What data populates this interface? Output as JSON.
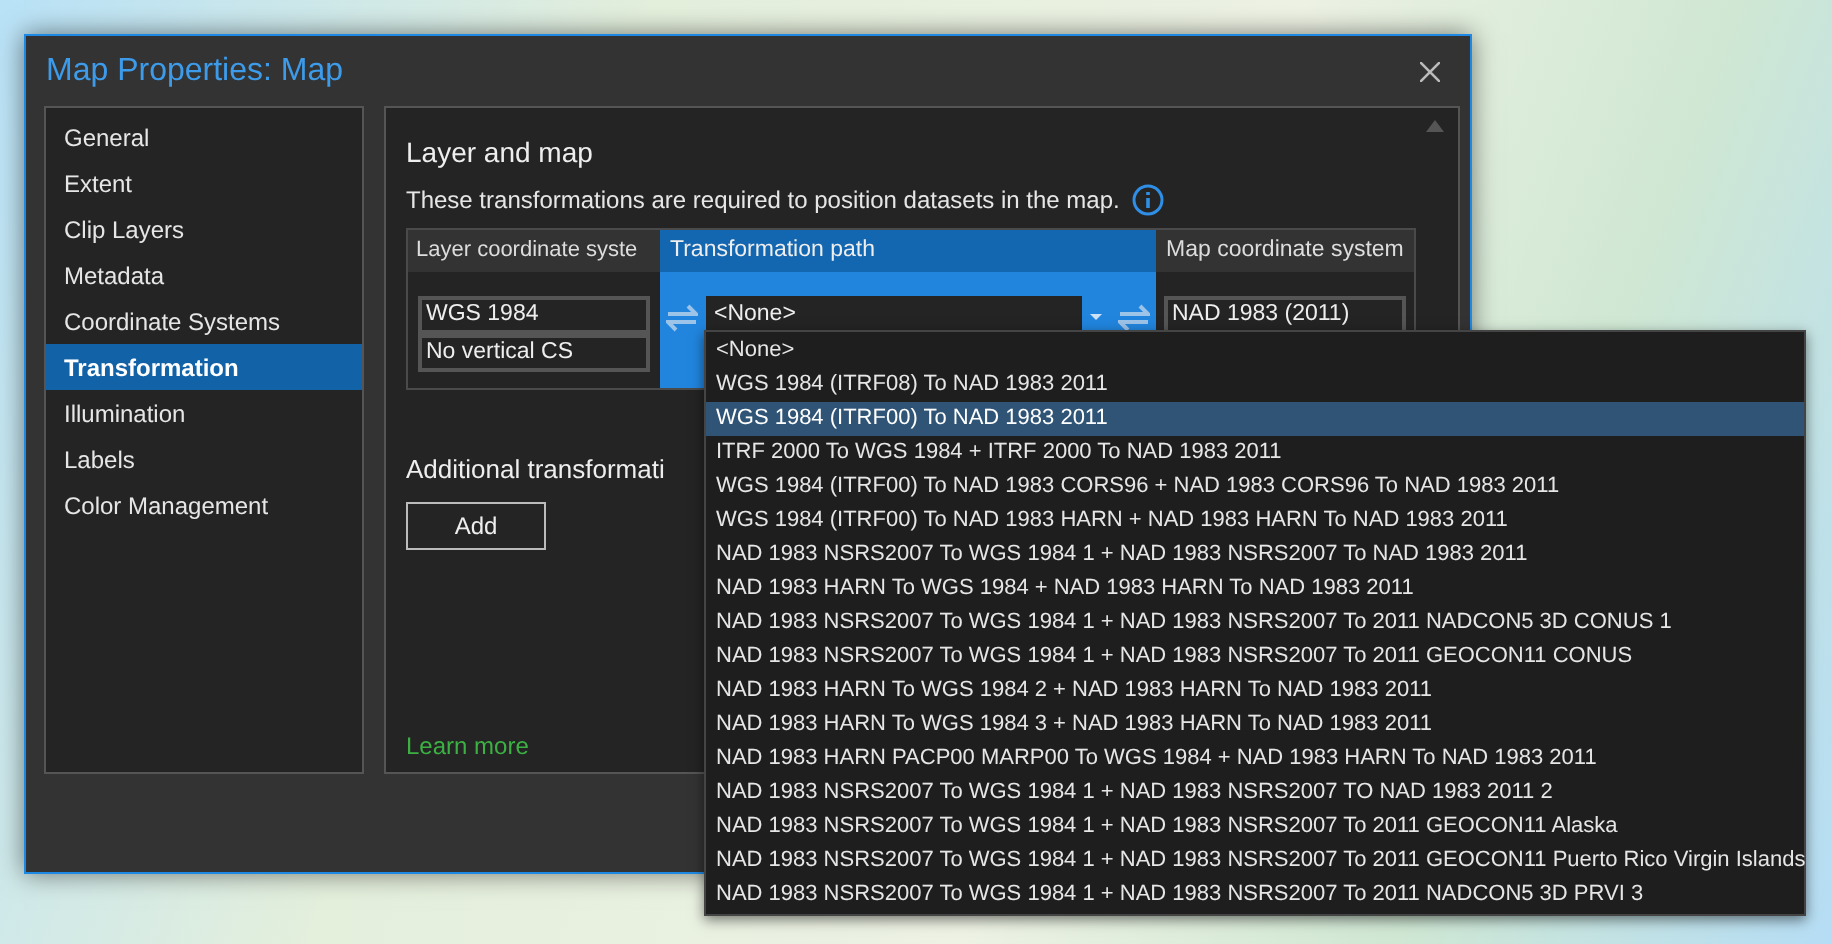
{
  "window": {
    "title": "Map Properties: Map"
  },
  "sidebar": {
    "items": [
      {
        "label": "General",
        "selected": false
      },
      {
        "label": "Extent",
        "selected": false
      },
      {
        "label": "Clip Layers",
        "selected": false
      },
      {
        "label": "Metadata",
        "selected": false
      },
      {
        "label": "Coordinate Systems",
        "selected": false
      },
      {
        "label": "Transformation",
        "selected": true
      },
      {
        "label": "Illumination",
        "selected": false
      },
      {
        "label": "Labels",
        "selected": false
      },
      {
        "label": "Color Management",
        "selected": false
      }
    ]
  },
  "section": {
    "heading": "Layer and map",
    "description": "These transformations are required to position datasets in the map."
  },
  "table": {
    "columns": [
      "Layer coordinate syste",
      "Transformation path",
      "Map coordinate system"
    ],
    "layer_cs": [
      "WGS 1984",
      "No vertical CS"
    ],
    "transformation_value": "<None>",
    "map_cs": [
      "NAD 1983 (2011)"
    ]
  },
  "additional": {
    "heading": "Additional transformati",
    "button": "Add"
  },
  "learn_more": "Learn more",
  "dropdown": {
    "options": [
      {
        "label": "<None>",
        "selected": false
      },
      {
        "label": "WGS 1984 (ITRF08) To NAD 1983 2011",
        "selected": false
      },
      {
        "label": "WGS 1984 (ITRF00) To NAD 1983 2011",
        "selected": true
      },
      {
        "label": "ITRF 2000 To WGS 1984 + ITRF 2000 To NAD 1983 2011",
        "selected": false
      },
      {
        "label": "WGS 1984 (ITRF00) To NAD 1983 CORS96 + NAD 1983 CORS96 To NAD 1983 2011",
        "selected": false
      },
      {
        "label": "WGS 1984 (ITRF00) To NAD 1983 HARN + NAD 1983 HARN To NAD 1983 2011",
        "selected": false
      },
      {
        "label": "NAD 1983 NSRS2007 To WGS 1984 1 + NAD 1983 NSRS2007 To NAD 1983 2011",
        "selected": false
      },
      {
        "label": "NAD 1983 HARN To WGS 1984 + NAD 1983 HARN To NAD 1983 2011",
        "selected": false
      },
      {
        "label": "NAD 1983 NSRS2007 To WGS 1984 1 + NAD 1983 NSRS2007 To 2011 NADCON5 3D CONUS 1",
        "selected": false
      },
      {
        "label": "NAD 1983 NSRS2007 To WGS 1984 1 + NAD 1983 NSRS2007 To 2011 GEOCON11 CONUS",
        "selected": false
      },
      {
        "label": "NAD 1983 HARN To WGS 1984 2 + NAD 1983 HARN To NAD 1983 2011",
        "selected": false
      },
      {
        "label": "NAD 1983 HARN To WGS 1984 3 + NAD 1983 HARN To NAD 1983 2011",
        "selected": false
      },
      {
        "label": "NAD 1983 HARN PACP00 MARP00 To WGS 1984 + NAD 1983 HARN To NAD 1983 2011",
        "selected": false
      },
      {
        "label": "NAD 1983 NSRS2007 To WGS 1984 1 + NAD 1983 NSRS2007 TO NAD 1983 2011 2",
        "selected": false
      },
      {
        "label": "NAD 1983 NSRS2007 To WGS 1984 1 + NAD 1983 NSRS2007 To 2011 GEOCON11 Alaska",
        "selected": false
      },
      {
        "label": "NAD 1983 NSRS2007 To WGS 1984 1 + NAD 1983 NSRS2007 To 2011 GEOCON11 Puerto Rico Virgin Islands",
        "selected": false
      },
      {
        "label": "NAD 1983 NSRS2007 To WGS 1984 1 + NAD 1983 NSRS2007 To 2011 NADCON5 3D PRVI 3",
        "selected": false
      }
    ]
  }
}
